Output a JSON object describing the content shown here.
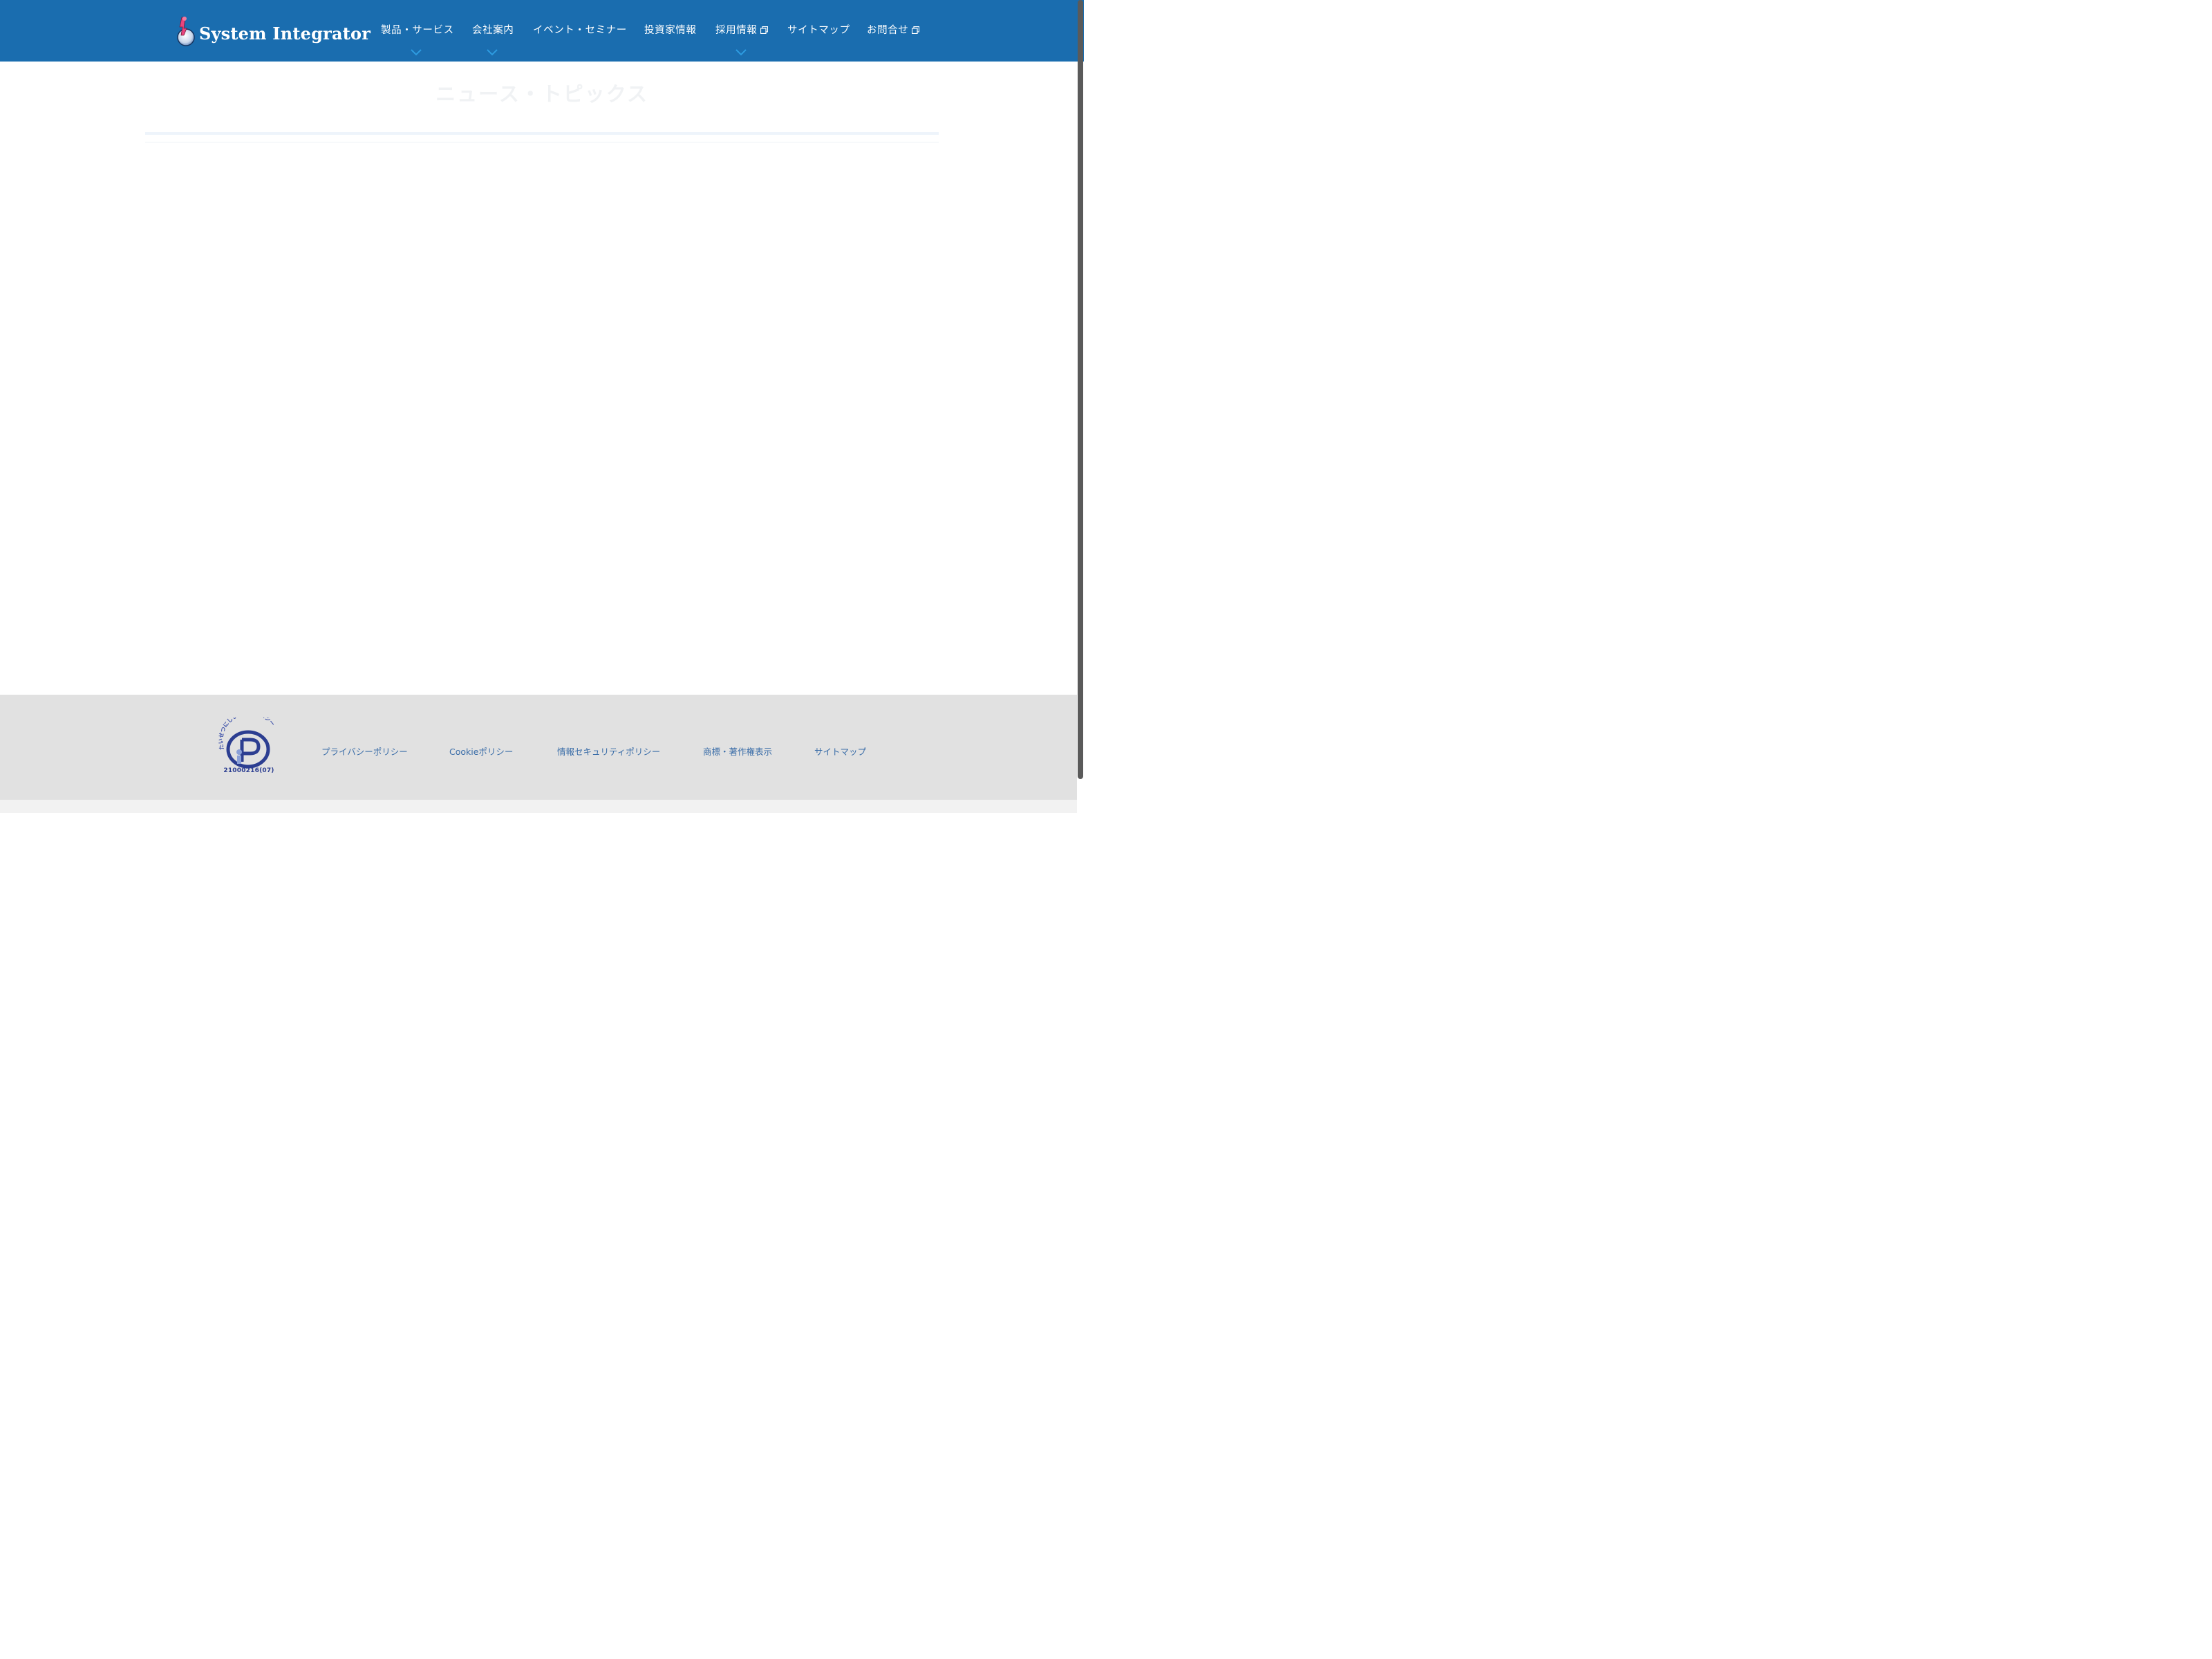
{
  "header": {
    "logo_text": "System Integrator",
    "colors": {
      "background": "#1a6daf",
      "chevron": "#2d9be0"
    },
    "nav": [
      {
        "label": "製品・サービス",
        "has_dropdown": true,
        "external": false
      },
      {
        "label": "会社案内",
        "has_dropdown": true,
        "external": false
      },
      {
        "label": "イベント・セミナー",
        "has_dropdown": false,
        "external": false
      },
      {
        "label": "投資家情報",
        "has_dropdown": false,
        "external": false
      },
      {
        "label": "採用情報",
        "has_dropdown": true,
        "external": true
      },
      {
        "label": "サイトマップ",
        "has_dropdown": false,
        "external": false
      },
      {
        "label": "お問合せ",
        "has_dropdown": false,
        "external": true
      }
    ]
  },
  "main": {
    "title": "ニュース・トピックス"
  },
  "footer": {
    "privacy_mark": {
      "arc_text": "たいせつにしますプライバシー",
      "number": "21000216(07)"
    },
    "links": [
      {
        "label": "プライバシーポリシー"
      },
      {
        "label": "Cookieポリシー"
      },
      {
        "label": "情報セキュリティポリシー"
      },
      {
        "label": "商標・著作権表示"
      },
      {
        "label": "サイトマップ"
      }
    ]
  }
}
